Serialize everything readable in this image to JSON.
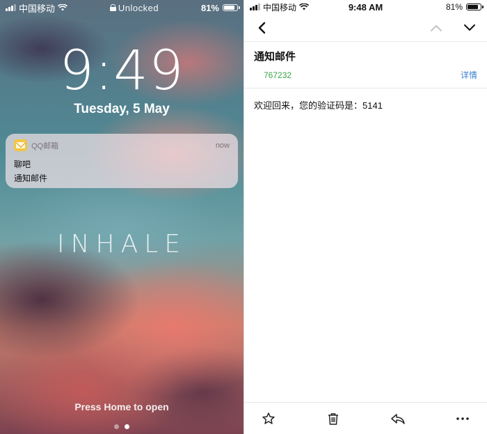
{
  "lock_screen": {
    "status": {
      "carrier": "中国移动",
      "center_text": "Unlocked",
      "battery": "81%"
    },
    "time": "9:49",
    "date": "Tuesday, 5 May",
    "notification": {
      "app": "QQ邮箱",
      "time": "now",
      "title": "聊吧",
      "body": "通知邮件"
    },
    "wallpaper_text": "INHALE",
    "hint": "Press Home to open",
    "page_dots": 2,
    "active_dot": 1
  },
  "mail_app": {
    "status": {
      "carrier": "中国移动",
      "time": "9:48 AM",
      "battery": "81%"
    },
    "subject": "通知邮件",
    "sender": "767232",
    "details_label": "详情",
    "body": "欢迎回来，您的验证码是：5141",
    "toolbar_icons": [
      "star-icon",
      "trash-icon",
      "reply-icon",
      "more-icon"
    ]
  },
  "colors": {
    "sender": "#3aa64a",
    "link": "#3b7fd1",
    "notification_icon": "#f3c542"
  }
}
